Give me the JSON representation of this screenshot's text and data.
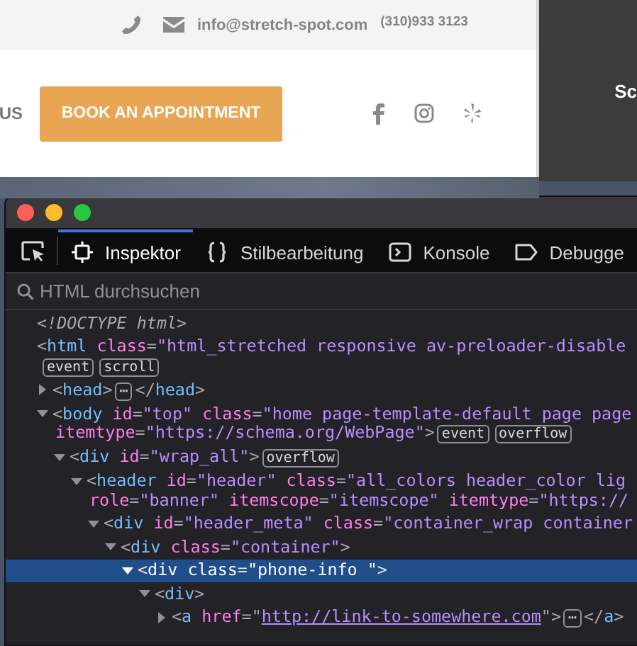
{
  "website": {
    "email": "info@stretch-spot.com",
    "phone": "(310)933 3123",
    "nav_item": "US",
    "cta_button": "BOOK AN APPOINTMENT"
  },
  "side_panel": {
    "text": "Sc"
  },
  "devtools": {
    "tabs": [
      {
        "kind": "inspector",
        "label": "Inspektor",
        "selected": true
      },
      {
        "kind": "style",
        "label": "Stilbearbeitung",
        "selected": false
      },
      {
        "kind": "console",
        "label": "Konsole",
        "selected": false
      },
      {
        "kind": "debugger",
        "label": "Debugge",
        "selected": false
      }
    ],
    "search": {
      "placeholder": "HTML durchsuchen"
    },
    "tree": [
      {
        "lines": [
          [
            {
              "kind": "doctype",
              "text": "<!DOCTYPE html>"
            }
          ]
        ],
        "selected": false
      },
      {
        "lines": [
          [
            {
              "kind": "punct",
              "text": "<"
            },
            {
              "kind": "tag",
              "text": "html"
            },
            {
              "kind": "attr",
              "text": "class"
            },
            {
              "kind": "punct",
              "text": "="
            },
            {
              "kind": "value",
              "text": "\"html_stretched responsive av-preloader-disable"
            }
          ],
          [
            {
              "kind": "badge",
              "text": "event"
            },
            {
              "kind": "badge",
              "text": "scroll"
            }
          ]
        ],
        "selected": false,
        "children": [
          {
            "expanded": false,
            "selected": false,
            "lines": [
              [
                {
                  "kind": "punct",
                  "text": "<"
                },
                {
                  "kind": "tag",
                  "text": "head"
                },
                {
                  "kind": "punct",
                  "text": ">"
                },
                {
                  "kind": "badge",
                  "text": "⋯"
                },
                {
                  "kind": "punct",
                  "text": "</"
                },
                {
                  "kind": "tag",
                  "text": "head"
                },
                {
                  "kind": "punct",
                  "text": ">"
                }
              ]
            ]
          },
          {
            "expanded": true,
            "selected": false,
            "lines": [
              [
                {
                  "kind": "punct",
                  "text": "<"
                },
                {
                  "kind": "tag",
                  "text": "body"
                },
                {
                  "kind": "attr",
                  "text": "id"
                },
                {
                  "kind": "punct",
                  "text": "="
                },
                {
                  "kind": "value",
                  "text": "\"top\""
                },
                {
                  "kind": "attr",
                  "text": "class"
                },
                {
                  "kind": "punct",
                  "text": "="
                },
                {
                  "kind": "value",
                  "text": "\"home page-template-default page page"
                }
              ],
              [
                {
                  "kind": "attr",
                  "text": "itemtype"
                },
                {
                  "kind": "punct",
                  "text": "="
                },
                {
                  "kind": "value",
                  "text": "\"https://schema.org/WebPage\""
                },
                {
                  "kind": "punct",
                  "text": ">"
                },
                {
                  "kind": "badge",
                  "text": "event"
                },
                {
                  "kind": "badge",
                  "text": "overflow"
                }
              ]
            ],
            "children": [
              {
                "expanded": true,
                "selected": false,
                "lines": [
                  [
                    {
                      "kind": "punct",
                      "text": "<"
                    },
                    {
                      "kind": "tag",
                      "text": "div"
                    },
                    {
                      "kind": "attr",
                      "text": "id"
                    },
                    {
                      "kind": "punct",
                      "text": "="
                    },
                    {
                      "kind": "value",
                      "text": "\"wrap_all\""
                    },
                    {
                      "kind": "punct",
                      "text": ">"
                    },
                    {
                      "kind": "badge",
                      "text": "overflow"
                    }
                  ]
                ],
                "children": [
                  {
                    "expanded": true,
                    "selected": false,
                    "lines": [
                      [
                        {
                          "kind": "punct",
                          "text": "<"
                        },
                        {
                          "kind": "tag",
                          "text": "header"
                        },
                        {
                          "kind": "attr",
                          "text": "id"
                        },
                        {
                          "kind": "punct",
                          "text": "="
                        },
                        {
                          "kind": "value",
                          "text": "\"header\""
                        },
                        {
                          "kind": "attr",
                          "text": "class"
                        },
                        {
                          "kind": "punct",
                          "text": "="
                        },
                        {
                          "kind": "value",
                          "text": "\"all_colors header_color lig"
                        }
                      ],
                      [
                        {
                          "kind": "attr",
                          "text": "role"
                        },
                        {
                          "kind": "punct",
                          "text": "="
                        },
                        {
                          "kind": "value",
                          "text": "\"banner\""
                        },
                        {
                          "kind": "attr",
                          "text": "itemscope"
                        },
                        {
                          "kind": "punct",
                          "text": "="
                        },
                        {
                          "kind": "value",
                          "text": "\"itemscope\""
                        },
                        {
                          "kind": "attr",
                          "text": "itemtype"
                        },
                        {
                          "kind": "punct",
                          "text": "="
                        },
                        {
                          "kind": "value",
                          "text": "\"https://"
                        }
                      ]
                    ],
                    "children": [
                      {
                        "expanded": true,
                        "selected": false,
                        "lines": [
                          [
                            {
                              "kind": "punct",
                              "text": "<"
                            },
                            {
                              "kind": "tag",
                              "text": "div"
                            },
                            {
                              "kind": "attr",
                              "text": "id"
                            },
                            {
                              "kind": "punct",
                              "text": "="
                            },
                            {
                              "kind": "value",
                              "text": "\"header_meta\""
                            },
                            {
                              "kind": "attr",
                              "text": "class"
                            },
                            {
                              "kind": "punct",
                              "text": "="
                            },
                            {
                              "kind": "value",
                              "text": "\"container_wrap container"
                            }
                          ]
                        ],
                        "children": [
                          {
                            "expanded": true,
                            "selected": false,
                            "lines": [
                              [
                                {
                                  "kind": "punct",
                                  "text": "<"
                                },
                                {
                                  "kind": "tag",
                                  "text": "div"
                                },
                                {
                                  "kind": "attr",
                                  "text": "class"
                                },
                                {
                                  "kind": "punct",
                                  "text": "="
                                },
                                {
                                  "kind": "value",
                                  "text": "\"container\""
                                },
                                {
                                  "kind": "punct",
                                  "text": ">"
                                }
                              ]
                            ],
                            "children": [
                              {
                                "expanded": true,
                                "selected": true,
                                "lines": [
                                  [
                                    {
                                      "kind": "punct",
                                      "text": "<"
                                    },
                                    {
                                      "kind": "tag",
                                      "text": "div"
                                    },
                                    {
                                      "kind": "attr",
                                      "text": "class"
                                    },
                                    {
                                      "kind": "punct",
                                      "text": "="
                                    },
                                    {
                                      "kind": "value",
                                      "text": "\"phone-info \""
                                    },
                                    {
                                      "kind": "punct",
                                      "text": ">"
                                    }
                                  ]
                                ],
                                "children": [
                                  {
                                    "expanded": true,
                                    "selected": false,
                                    "lines": [
                                      [
                                        {
                                          "kind": "punct",
                                          "text": "<"
                                        },
                                        {
                                          "kind": "tag",
                                          "text": "div"
                                        },
                                        {
                                          "kind": "punct",
                                          "text": ">"
                                        }
                                      ]
                                    ],
                                    "children": [
                                      {
                                        "expanded": false,
                                        "selected": false,
                                        "lines": [
                                          [
                                            {
                                              "kind": "punct",
                                              "text": "<"
                                            },
                                            {
                                              "kind": "tag",
                                              "text": "a"
                                            },
                                            {
                                              "kind": "attr",
                                              "text": "href"
                                            },
                                            {
                                              "kind": "punct",
                                              "text": "="
                                            },
                                            {
                                              "kind": "punct",
                                              "text": "\""
                                            },
                                            {
                                              "kind": "link",
                                              "text": "http://link-to-somewhere.com"
                                            },
                                            {
                                              "kind": "punct",
                                              "text": "\">"
                                            },
                                            {
                                              "kind": "badge",
                                              "text": "⋯"
                                            },
                                            {
                                              "kind": "punct",
                                              "text": "</"
                                            },
                                            {
                                              "kind": "tag",
                                              "text": "a"
                                            },
                                            {
                                              "kind": "punct",
                                              "text": ">"
                                            }
                                          ]
                                        ]
                                      }
                                    ]
                                  }
                                ]
                              }
                            ]
                          }
                        ]
                      }
                    ]
                  }
                ]
              }
            ]
          }
        ]
      }
    ]
  }
}
